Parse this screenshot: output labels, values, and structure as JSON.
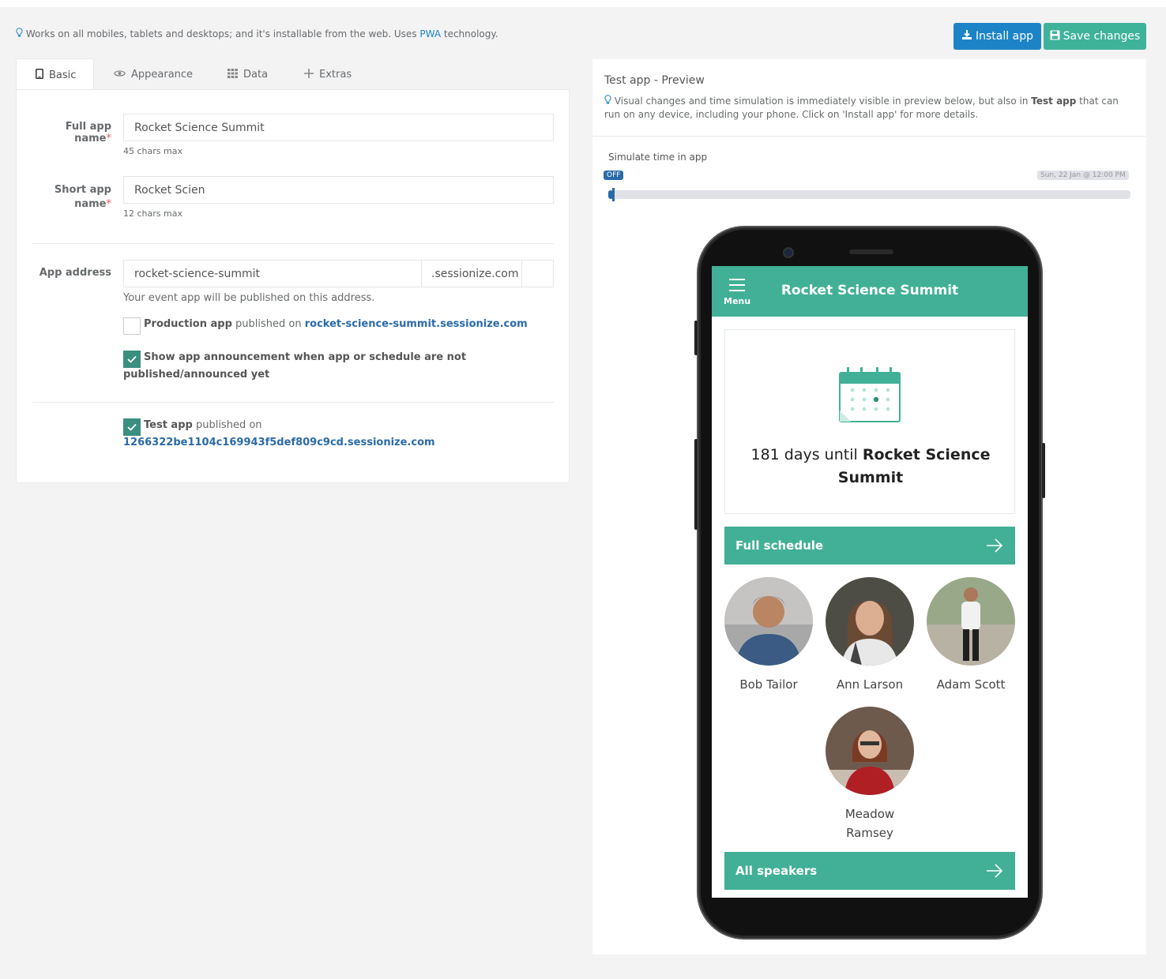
{
  "info": {
    "text_before": "Works on all mobiles, tablets and desktops; and it's installable from the web. Uses ",
    "pwa": "PWA",
    "text_after": " technology."
  },
  "actions": {
    "install_label": "Install app",
    "save_label": "Save changes"
  },
  "tabs": [
    {
      "label": "Basic",
      "icon": "tablet-icon",
      "active": true
    },
    {
      "label": "Appearance",
      "icon": "eye-icon",
      "active": false
    },
    {
      "label": "Data",
      "icon": "grid-icon",
      "active": false
    },
    {
      "label": "Extras",
      "icon": "plus-icon",
      "active": false
    }
  ],
  "form": {
    "full_name": {
      "label": "Full app name",
      "required_mark": "*",
      "value": "Rocket Science Summit",
      "hint": "45 chars max"
    },
    "short_name": {
      "label_line1": "Short app",
      "label_line2": "name",
      "required_mark": "*",
      "value": "Rocket Scien",
      "hint": "12 chars max"
    },
    "address": {
      "label": "App address",
      "value": "rocket-science-summit",
      "suffix": ".sessionize.com",
      "hint": "Your event app will be published on this address."
    },
    "production": {
      "checked": false,
      "bold": "Production app",
      "text": " published on ",
      "link": "rocket-science-summit.sessionize.com"
    },
    "announcement": {
      "checked": true,
      "line1": "Show app announcement when app or schedule are not",
      "line2": "published/announced yet"
    },
    "test_app": {
      "checked": true,
      "bold": "Test app",
      "text": " published on",
      "link": "1266322be1104c169943f5def809c9cd.sessionize.com"
    }
  },
  "preview": {
    "title": "Test app - Preview",
    "desc_before": "Visual changes and time simulation is immediately visible in preview below, but also in ",
    "desc_bold": "Test app",
    "desc_after": " that can run on any device, including your phone. Click on 'Install app' for more details.",
    "simulate_label": "Simulate time in app",
    "slider_state": "OFF",
    "slider_date": "Sun, 22 Jan @ 12:00 PM",
    "slider_position": 0.0
  },
  "app": {
    "menu_label": "Menu",
    "title": "Rocket Science Summit",
    "countdown_prefix": "181 days until ",
    "countdown_event": "Rocket Science Summit",
    "schedule_button": "Full schedule",
    "speakers_button": "All speakers",
    "speakers": [
      {
        "name": "Bob Tailor"
      },
      {
        "name": "Ann Larson"
      },
      {
        "name": "Adam Scott"
      },
      {
        "name_line1": "Meadow",
        "name_line2": "Ramsey"
      }
    ]
  },
  "colors": {
    "primary_blue": "#1c84c6",
    "primary_green": "#3fb29a",
    "app_green": "#42b096"
  }
}
